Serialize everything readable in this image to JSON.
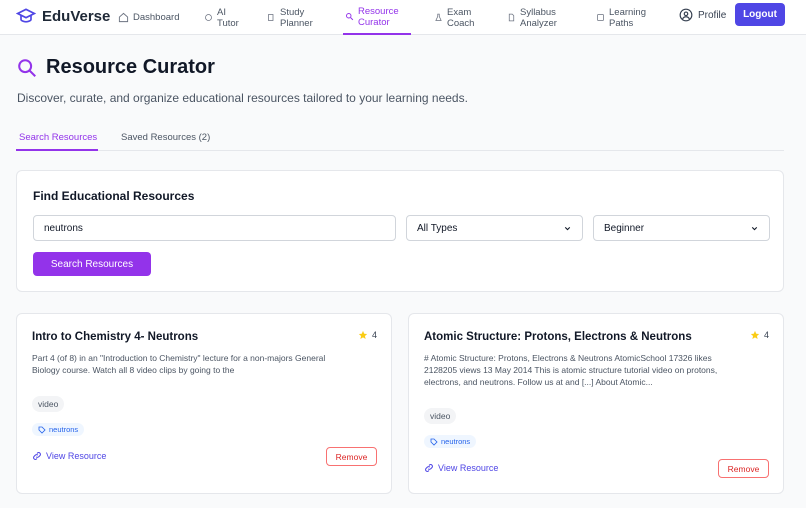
{
  "nav": {
    "brand": "EduVerse",
    "items": [
      {
        "label": "Dashboard"
      },
      {
        "label": "AI\nTutor"
      },
      {
        "label": "Study\nPlanner"
      },
      {
        "label": "Resource\nCurator"
      },
      {
        "label": "Exam\nCoach"
      },
      {
        "label": "Syllabus\nAnalyzer"
      },
      {
        "label": "Learning\nPaths"
      }
    ],
    "profile": "Profile",
    "logout": "Logout",
    "accent": "#9333ea",
    "logout_color": "#4f46e5"
  },
  "header": {
    "title": "Resource Curator",
    "subtitle": "Discover, curate, and organize educational resources tailored to your learning needs."
  },
  "tabs": [
    {
      "label": "Search Resources",
      "active": true
    },
    {
      "label": "Saved Resources (2)",
      "active": false
    }
  ],
  "search": {
    "heading": "Find Educational Resources",
    "query": "neutrons",
    "type_selected": "All Types",
    "level_selected": "Beginner",
    "button": "Search Resources"
  },
  "results": [
    {
      "title": "Intro to Chemistry 4- Neutrons",
      "rating": "4",
      "description": "Part 4 (of 8) in an \"Introduction to Chemistry\" lecture for a non-majors General Biology course. Watch all 8 video clips by going to the",
      "type": "video",
      "tag": "neutrons",
      "view": "View Resource",
      "remove": "Remove"
    },
    {
      "title": "Atomic Structure: Protons, Electrons & Neutrons",
      "rating": "4",
      "description": "# Atomic Structure: Protons, Electrons & Neutrons AtomicSchool 17326 likes 2128205 views 13 May 2014 This is atomic structure tutorial video on protons, electrons, and neutrons. Follow us at and [...] About Atomic...",
      "type": "video",
      "tag": "neutrons",
      "view": "View Resource",
      "remove": "Remove"
    }
  ]
}
